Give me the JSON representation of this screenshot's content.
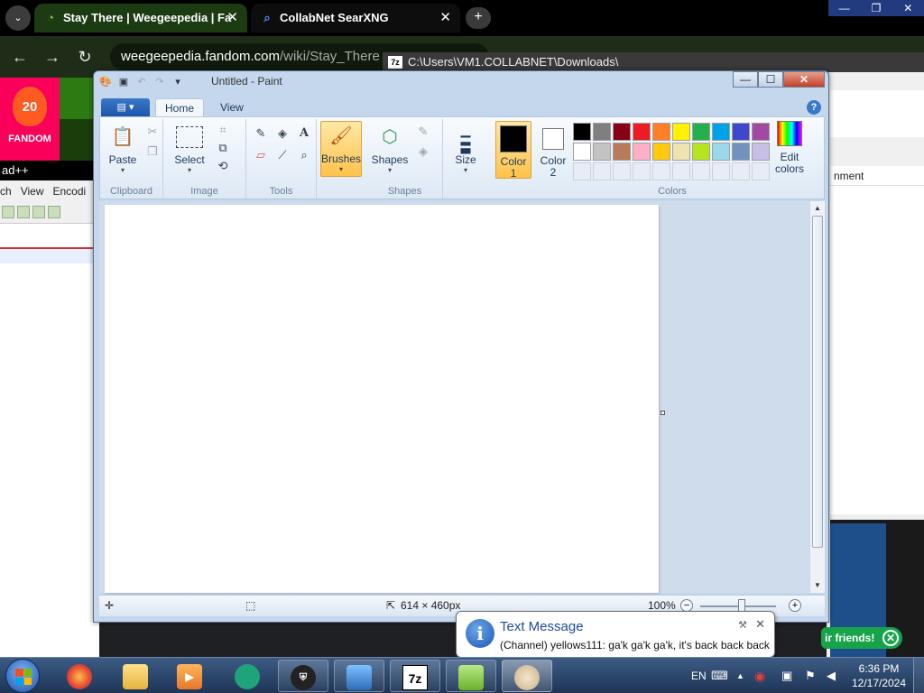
{
  "chrome": {
    "tabs": [
      {
        "label": "Stay There | Weegeepedia | Fa",
        "icon": "weegee-favicon"
      },
      {
        "label": "CollabNet SearXNG",
        "icon": "search-icon"
      }
    ],
    "new_tab": "+",
    "tab_menu": "⌄",
    "close": "✕",
    "window_buttons": [
      "—",
      "❐",
      "✕"
    ],
    "nav": {
      "back": "←",
      "forward": "→",
      "reload": "↻",
      "tune": "⚙"
    },
    "url_host": "weegeepedia.fandom.com",
    "url_path": "/wiki/Stay_There",
    "fandom_badge": "20",
    "fandom_label": "FANDOM"
  },
  "notepadpp": {
    "title": "ad++",
    "menu": [
      "ch",
      "View",
      "Encodi"
    ]
  },
  "sevenzip": {
    "title": "C:\\Users\\VM1.COLLABNET\\Downloads\\",
    "icon_text": "7z",
    "column_header": "nment",
    "friends_text": "ir friends!",
    "friends_close": "✕"
  },
  "paint": {
    "title": "Untitled - Paint",
    "window_buttons": {
      "minimize": "—",
      "maximize": "☐",
      "close": "✕"
    },
    "qat_icons": [
      "paint-app-icon",
      "save-icon",
      "undo-icon",
      "redo-icon",
      "customize-qat-icon"
    ],
    "app_menu": "▤ ▾",
    "tabs": [
      {
        "label": "Home",
        "active": true
      },
      {
        "label": "View",
        "active": false
      }
    ],
    "help": "?",
    "groups": {
      "clipboard": {
        "label": "Clipboard",
        "paste": "Paste"
      },
      "image": {
        "label": "Image",
        "select": "Select"
      },
      "tools": {
        "label": "Tools"
      },
      "brushes": {
        "label": "Brushes"
      },
      "shapes": {
        "label": "Shapes",
        "shapes_btn": "Shapes"
      },
      "size": {
        "label": "Size"
      },
      "colors": {
        "label": "Colors",
        "color1_line1": "Color",
        "color1_line2": "1",
        "color2_line1": "Color",
        "color2_line2": "2",
        "edit_line1": "Edit",
        "edit_line2": "colors"
      }
    },
    "color1": "#000000",
    "color2": "#ffffff",
    "palette": [
      "#000000",
      "#7f7f7f",
      "#880015",
      "#ed1c24",
      "#ff7f27",
      "#fff200",
      "#22b14c",
      "#00a2e8",
      "#3f48cc",
      "#a349a4",
      "#ffffff",
      "#c3c3c3",
      "#b97a57",
      "#ffaec9",
      "#ffc90e",
      "#efe4b0",
      "#b5e61d",
      "#99d9ea",
      "#7092be",
      "#c8bfe7"
    ],
    "status": {
      "cursor_icon": "✛",
      "selection_icon": "⬚",
      "size_icon": "⇱",
      "size": "614 × 460px",
      "zoom": "100%",
      "zoom_out": "−",
      "zoom_in": "+"
    }
  },
  "notification": {
    "title": "Text Message",
    "message": "(Channel) yellows111: ga'k ga'k ga'k, it's back back back",
    "icon": "i",
    "pin": "🔧",
    "close": "✕"
  },
  "taskbar": {
    "apps": [
      "firefox",
      "explorer",
      "media-player",
      "chat-app",
      "ssh-client",
      "network-app",
      "7zip",
      "notepad-plus-plus",
      "paint"
    ],
    "sevenzip_label": "7z",
    "language": "EN",
    "time": "6:36 PM",
    "date": "12/17/2024"
  }
}
